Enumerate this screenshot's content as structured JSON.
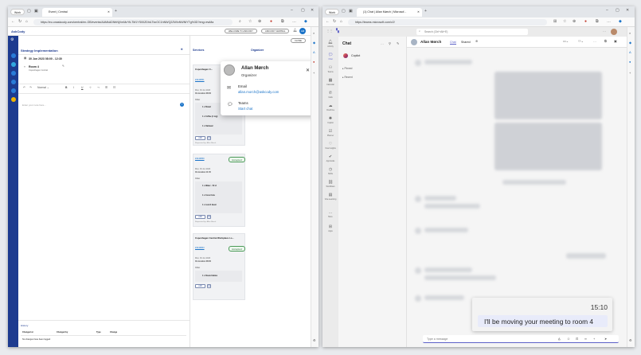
{
  "left_browser": {
    "profile_label": "Work",
    "tab_title": "Event | Central",
    "url": "https://eu.onaskcody.com/central/en-GB/events/AAMkADNhNjVmMzYtLTM1YS00ZDhiLTkxOC1hNWQ2ZWIxNWNlYTg%3D?eng=ewMa",
    "brand": "AskCody",
    "welcome_label": "WELCOME TO ASKCODY",
    "central_label": "ASKCODY CENTRAL",
    "close_label": "CLOSE",
    "avatar_initials": "AM",
    "event": {
      "title": "Strategy Implementation",
      "datetime": "30 Jun 2023 08:00 - 12:30",
      "room": "Room 4",
      "room_location": "Copenhagen Central",
      "editor_style": "Normal",
      "editor_placeholder": "Enter your note here...",
      "history_title": "History",
      "history_columns": [
        "Changed at",
        "Changed by",
        "Type",
        "Change"
      ],
      "history_empty": "No changes have been logged"
    },
    "services_label": "Services",
    "organizer_label": "Organizer",
    "services": [
      {
        "title": "Copenhagen C...",
        "id": "#4446851",
        "date": "Mon, 30 Jun 2023",
        "time": "On location 08:00",
        "order_label": "Order",
        "items": [
          "1 x Bread",
          "1 x Coffee (1 mg)",
          "1 x Oatmeal"
        ],
        "edit_label": "edit",
        "requested_by": "Requested by: Allan Mørch"
      },
      {
        "title": "",
        "id": "#4446859",
        "status": "Accepted",
        "date": "Mon, 30 Jun 2023",
        "time": "On location 11:45",
        "order_label": "Order",
        "items": [
          "1 x Water - 50 cl",
          "1 x Coca Cola",
          "1 x Lunch basic"
        ],
        "edit_label": "edit",
        "requested_by": "Requested by: Allan Mørch"
      },
      {
        "title": "Copenhagen Central Workplace Lo...",
        "id": "#4446863",
        "status": "Accepted",
        "date": "Mon, 30 Jun 2023",
        "time": "On location 08:00",
        "order_label": "Order",
        "items": [
          "1 x Round tables"
        ],
        "edit_label": "edit",
        "requested_by": "Requested by: Allan Mørch"
      }
    ],
    "popup": {
      "name": "Allan Mørch",
      "role": "Organizer",
      "email_label": "Email",
      "email": "allan.morch@askcody.com",
      "teams_label": "Teams",
      "teams_action": "Start chat"
    }
  },
  "right_browser": {
    "profile_label": "Work",
    "tab_title": "(1) Chat | Allan Mørch | Microsof...",
    "url": "https://teams.microsoft.com/v2/",
    "search_placeholder": "Search (Ctrl+Alt+E)",
    "nav_items": [
      "Activity",
      "Chat",
      "Teams",
      "Calendar",
      "Calls",
      "OneDrive",
      "Copilot",
      "Planner",
      "Viva Insights",
      "Approvals",
      "Shifts",
      "Workflows",
      "Viva Learning",
      "More",
      "Apps"
    ],
    "chat_title": "Chat",
    "copilot_label": "Copilot",
    "pinned_label": "Pinned",
    "recent_label": "Recent",
    "contact_name": "Allan Mørch",
    "conv_tabs": [
      "Chat",
      "Shared"
    ],
    "message_time": "15:10",
    "message_text": "I'll be moving your meeting to room 4",
    "compose_placeholder": "Type a message"
  },
  "colors": {
    "askcody_blue": "#1d3b8f",
    "teams_purple": "#5b5fc7",
    "link_blue": "#1a73c8",
    "accepted_green": "#4a9a57"
  }
}
